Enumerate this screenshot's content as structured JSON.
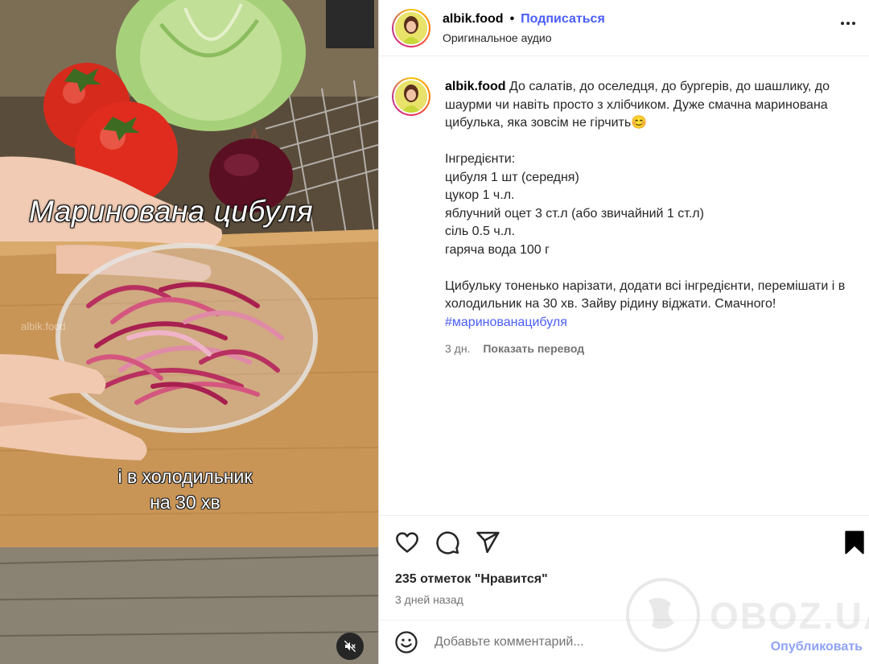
{
  "media": {
    "overlay_title": "Маринована цибуля",
    "overlay_sub_line1": "і в холодильник",
    "overlay_sub_line2": "на 30 хв",
    "watermark": "albik.food",
    "mute_icon": "speaker-muted-icon"
  },
  "header": {
    "username": "albik.food",
    "separator": "•",
    "follow_label": "Подписаться",
    "audio_label": "Оригинальное аудио",
    "more_icon": "more-horizontal-icon"
  },
  "caption": {
    "username": "albik.food",
    "intro": "До салатів, до оселедця, до бургерів, до шашлику, до шаурми чи навіть просто з хлібчиком. Дуже смачна маринована цибулька, яка зовсім не гірчить😊",
    "ingredients_title": "Інгредієнти:",
    "ingredients": [
      "цибуля 1 шт (середня)",
      "цукор 1 ч.л.",
      "яблучний оцет 3 ст.л (або звичайний 1 ст.л)",
      "сіль 0.5 ч.л.",
      "гаряча вода 100 г"
    ],
    "instructions": "Цибульку тоненько нарізати, додати всі інгредієнти, перемішати і в холодильник на 30 хв. Зайву рідину віджати. Смачного!",
    "hashtag": "#маринованацибуля",
    "age": "3 дн.",
    "translate_label": "Показать перевод"
  },
  "actions": {
    "like_icon": "heart-icon",
    "comment_icon": "comment-icon",
    "share_icon": "share-icon",
    "save_icon": "bookmark-icon",
    "likes_text": "235 отметок \"Нравится\"",
    "posted_ago": "3 дней назад"
  },
  "comment": {
    "emoji_icon": "emoji-icon",
    "placeholder": "Добавьте комментарий...",
    "publish_label": "Опубликовать"
  },
  "site_watermark": "OBOZ.UA",
  "colors": {
    "link": "#4a5df9",
    "publish_disabled": "#8ea2f8",
    "secondary_text": "#737373"
  }
}
